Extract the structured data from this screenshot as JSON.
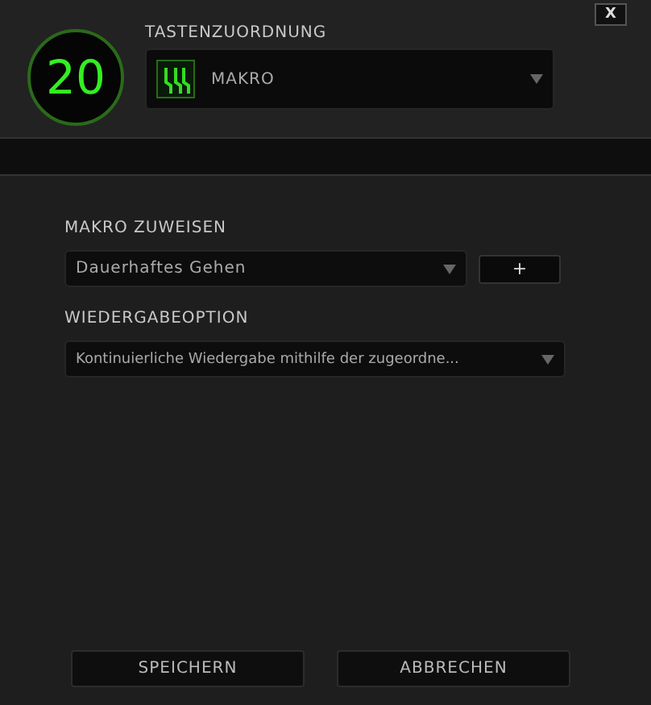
{
  "key_number": "20",
  "close_button": "X",
  "key_assignment": {
    "label": "TASTENZUORDNUNG",
    "value": "MAKRO"
  },
  "macro": {
    "label": "MAKRO ZUWEISEN",
    "value": "Dauerhaftes Gehen",
    "add_button": "+"
  },
  "playback": {
    "label": "WIEDERGABEOPTION",
    "value": "Kontinuierliche Wiedergabe mithilfe der zugeordne..."
  },
  "buttons": [
    "SPEICHERN",
    "ABBRECHEN"
  ]
}
